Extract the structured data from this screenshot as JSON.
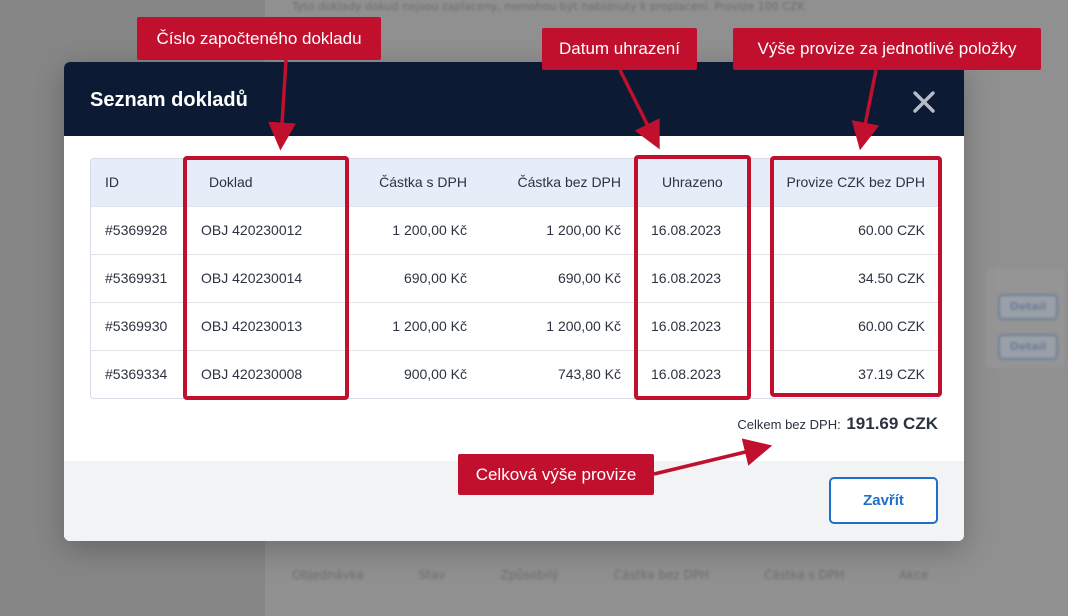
{
  "background": {
    "top_text": "Tyto doklady dokud nejsou zaplaceny, nemohou být nabídnuty k proplacení. Provize 100 CZK",
    "buttons": [
      "Detail",
      "Detail"
    ],
    "footer_columns": [
      "Objednávka",
      "Stav",
      "Způsobilý",
      "Částka bez DPH",
      "Částka s DPH",
      "Akce"
    ]
  },
  "modal": {
    "title": "Seznam dokladů",
    "close_icon": "close-icon",
    "table": {
      "headers": {
        "id": "ID",
        "doc": "Doklad",
        "amount": "Částka s DPH",
        "amount_net": "Částka bez DPH",
        "paid": "Uhrazeno",
        "commission": "Provize CZK bez DPH"
      },
      "rows": [
        {
          "id": "#5369928",
          "doc": "OBJ 420230012",
          "amount": "1 200,00 Kč",
          "amount_net": "1 200,00 Kč",
          "paid": "16.08.2023",
          "commission": "60.00 CZK"
        },
        {
          "id": "#5369931",
          "doc": "OBJ 420230014",
          "amount": "690,00 Kč",
          "amount_net": "690,00 Kč",
          "paid": "16.08.2023",
          "commission": "34.50 CZK"
        },
        {
          "id": "#5369930",
          "doc": "OBJ 420230013",
          "amount": "1 200,00 Kč",
          "amount_net": "1 200,00 Kč",
          "paid": "16.08.2023",
          "commission": "60.00 CZK"
        },
        {
          "id": "#5369334",
          "doc": "OBJ 420230008",
          "amount": "900,00 Kč",
          "amount_net": "743,80 Kč",
          "paid": "16.08.2023",
          "commission": "37.19 CZK"
        }
      ]
    },
    "total": {
      "label": "Celkem bez DPH:",
      "value": "191.69 CZK"
    },
    "close_button": "Zavřít"
  },
  "annotations": {
    "doc_number": "Číslo započteného dokladu",
    "paid_date": "Datum uhrazení",
    "commission_items": "Výše provize za jednotlivé položky",
    "total_commission": "Celková výše provize"
  },
  "colors": {
    "annotation": "#c0102e",
    "header_bg": "#0d1a33",
    "accent": "#1f6fc9"
  }
}
